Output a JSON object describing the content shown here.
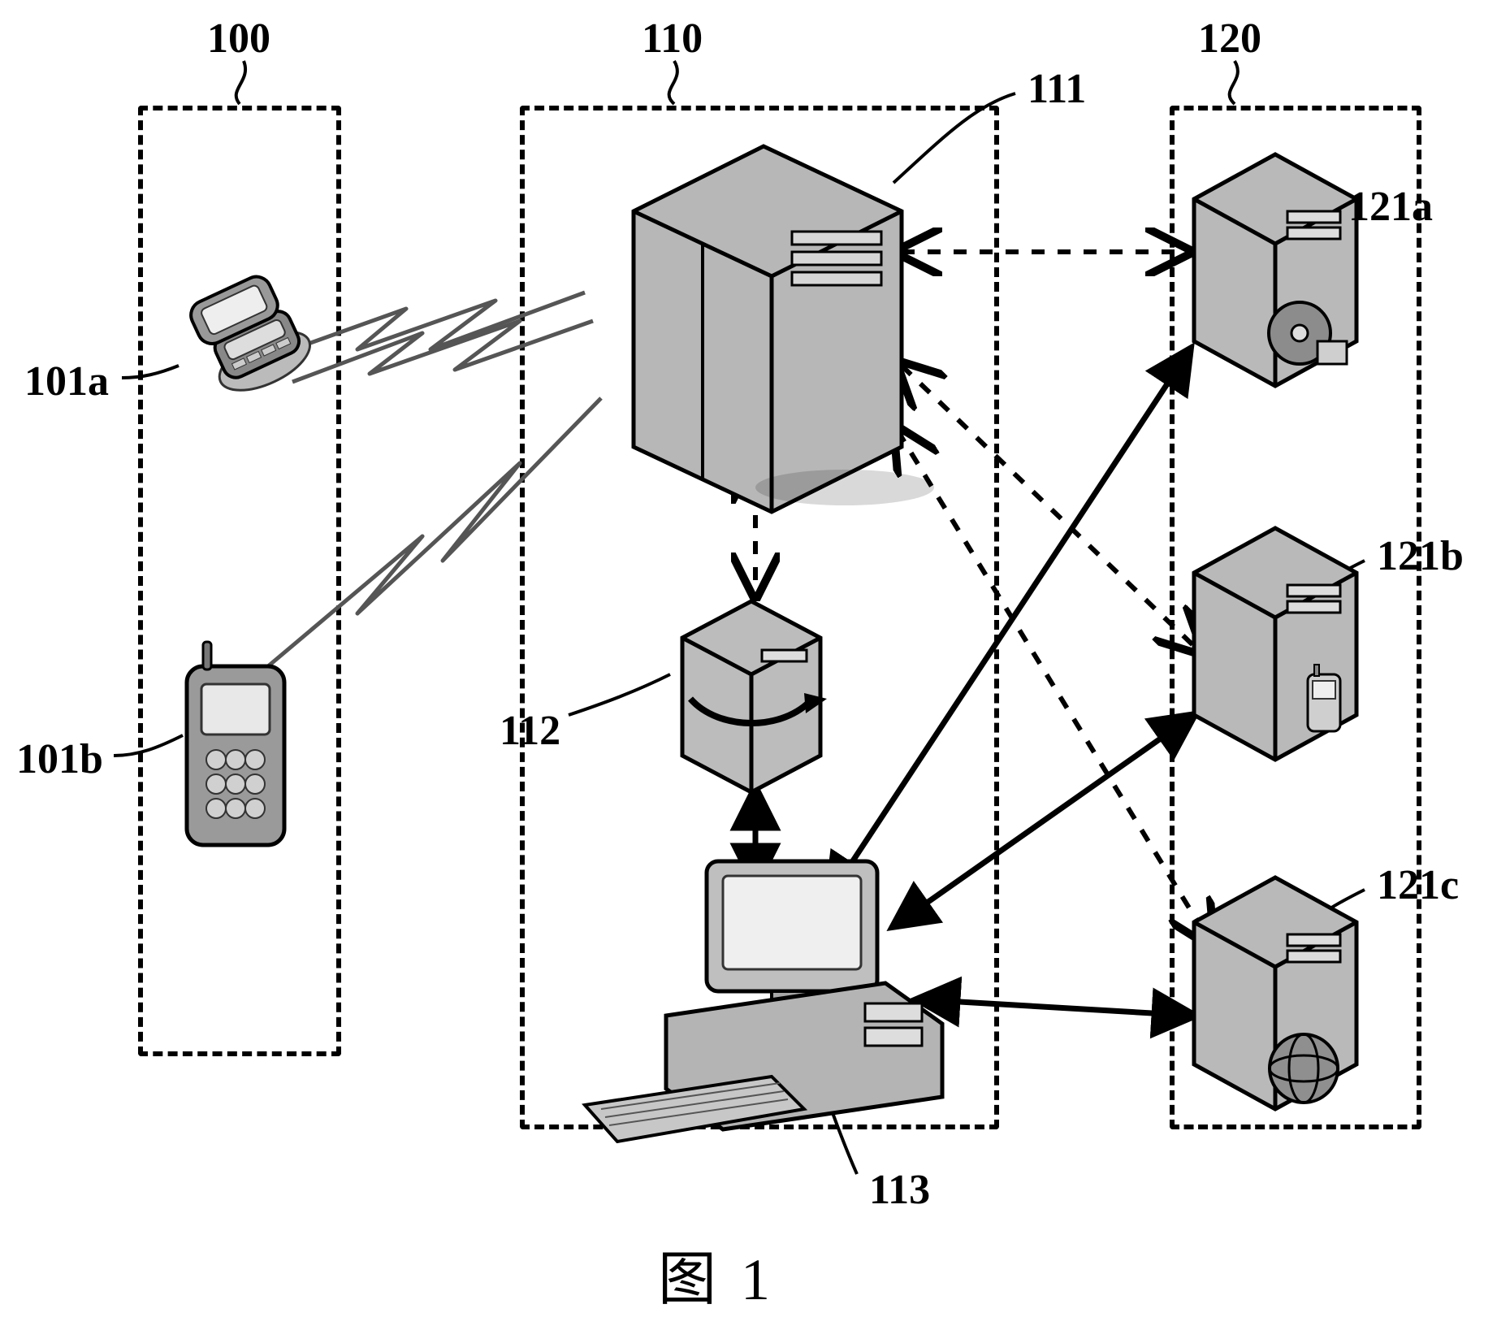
{
  "figure": {
    "caption": "图 1",
    "groups": {
      "g100": {
        "ref": "100"
      },
      "g110": {
        "ref": "110"
      },
      "g120": {
        "ref": "120"
      }
    },
    "nodes": {
      "n101a": {
        "ref": "101a"
      },
      "n101b": {
        "ref": "101b"
      },
      "n111": {
        "ref": "111"
      },
      "n112": {
        "ref": "112"
      },
      "n113": {
        "ref": "113"
      },
      "n121a": {
        "ref": "121a"
      },
      "n121b": {
        "ref": "121b"
      },
      "n121c": {
        "ref": "121c"
      }
    }
  }
}
